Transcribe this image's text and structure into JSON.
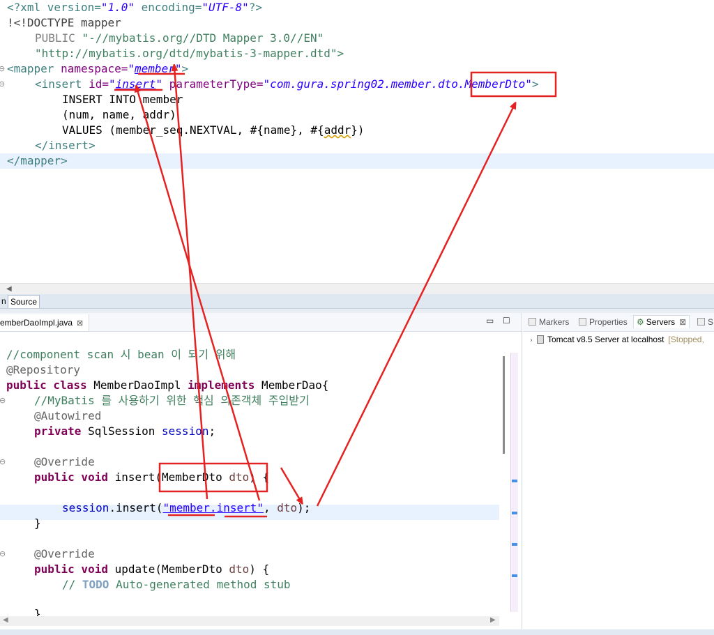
{
  "xml_editor": {
    "line1": {
      "p1": "<?xml version=",
      "v1": "\"1.0\"",
      "p2": " encoding=",
      "v2": "\"UTF-8\"",
      "p3": "?>"
    },
    "line2": "!<!DOCTYPE mapper",
    "line3": {
      "a": "PUBLIC ",
      "b": "\"-//mybatis.org//DTD Mapper 3.0//EN\""
    },
    "line4": "\"http://mybatis.org/dtd/mybatis-3-mapper.dtd\">",
    "line5": {
      "tag": "<mapper ",
      "attr": "namespace=",
      "q1": "\"",
      "val": "member",
      "q2": "\"",
      "end": ">"
    },
    "line6": {
      "tag": "<insert ",
      "attr1": "id=",
      "q1": "\"",
      "val1": "insert",
      "q2": "\"",
      "attr2": " parameterType=",
      "val2": "\"com.gura.spring02.member.dto.MemberDto\"",
      "end": ">"
    },
    "line7": "INSERT INTO member",
    "line8": "(num, name, addr)",
    "line9": {
      "a": "VALUES (member_seq.NEXTVAL, #{name}, #{",
      "b": "addr",
      "c": "})"
    },
    "line10": "</insert>",
    "line11": "</mapper>"
  },
  "tabs": {
    "design": "n",
    "source": "Source"
  },
  "java_editor": {
    "tab_label": "emberDaoImpl.java",
    "close_glyph": "⊠",
    "min_glyph": "▭",
    "max_glyph": "☐",
    "lines": {
      "l1": "//component scan 시 bean 이 되기 위해",
      "l2": "@Repository",
      "l3": {
        "kw1": "public class",
        "name": " MemberDaoImpl ",
        "kw2": "implements",
        "rest": " MemberDao{"
      },
      "l4": "//MyBatis 를 사용하기 위한 핵심 의존객체 주입받기",
      "l5": "@Autowired",
      "l6": {
        "kw": "private",
        "type": " SqlSession ",
        "fld": "session",
        "end": ";"
      },
      "l7": "@Override",
      "l8": {
        "kw": "public void",
        "name": " insert(MemberDto ",
        "param": "dto",
        "end": ") {"
      },
      "l9": {
        "a": "session",
        "b": ".insert(",
        "c": "\"member.insert\"",
        "d": ", ",
        "e": "dto",
        "f": ");"
      },
      "l10": "}",
      "l11": "@Override",
      "l12": {
        "kw": "public void",
        "name": " update(MemberDto ",
        "param": "dto",
        "end": ") {"
      },
      "l13": {
        "a": "// ",
        "todo": "TODO",
        "b": " Auto-generated method stub"
      },
      "l14": "}"
    }
  },
  "servers_view": {
    "tabs": [
      "Markers",
      "Properties",
      "Servers",
      "S"
    ],
    "server_name": "Tomcat v8.5 Server at localhost",
    "server_status": "[Stopped,"
  },
  "colors": {
    "annotation": "#e52222",
    "current_line": "#e8f2fe"
  }
}
